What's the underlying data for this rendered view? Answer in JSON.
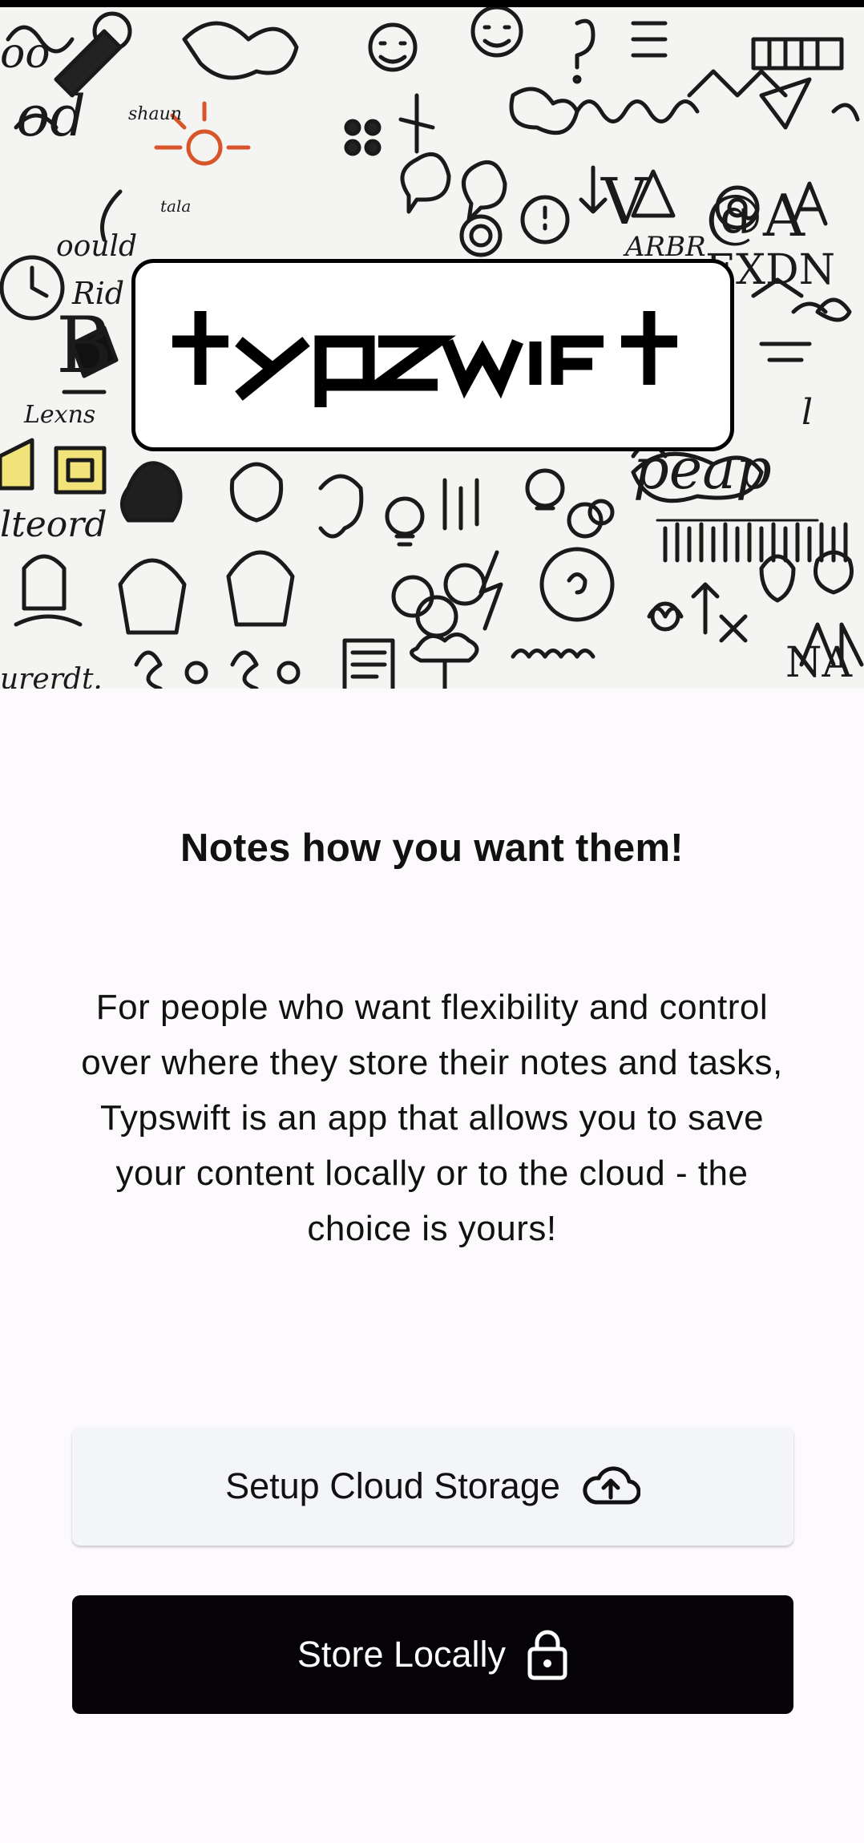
{
  "hero": {
    "logo_text": "typswift",
    "doodle_icons": [
      "face-doodle",
      "lightbulb-doodle",
      "question-doodle",
      "at-sign-doodle",
      "cloud-doodle",
      "pencil-doodle",
      "clock-doodle",
      "note-doodle",
      "arrow-doodle"
    ]
  },
  "content": {
    "headline": "Notes how you want them!",
    "description": "For people who want flexibility and control over where they store their notes and tasks, Typswift is an app that allows you to save your content locally or to the cloud - the choice is yours!"
  },
  "actions": {
    "cloud_label": "Setup Cloud Storage",
    "cloud_icon": "cloud-upload-icon",
    "local_label": "Store Locally",
    "local_icon": "lock-icon"
  },
  "colors": {
    "background": "#fdfafd",
    "primary_button": "#060308",
    "secondary_button": "#f4f5f8"
  }
}
